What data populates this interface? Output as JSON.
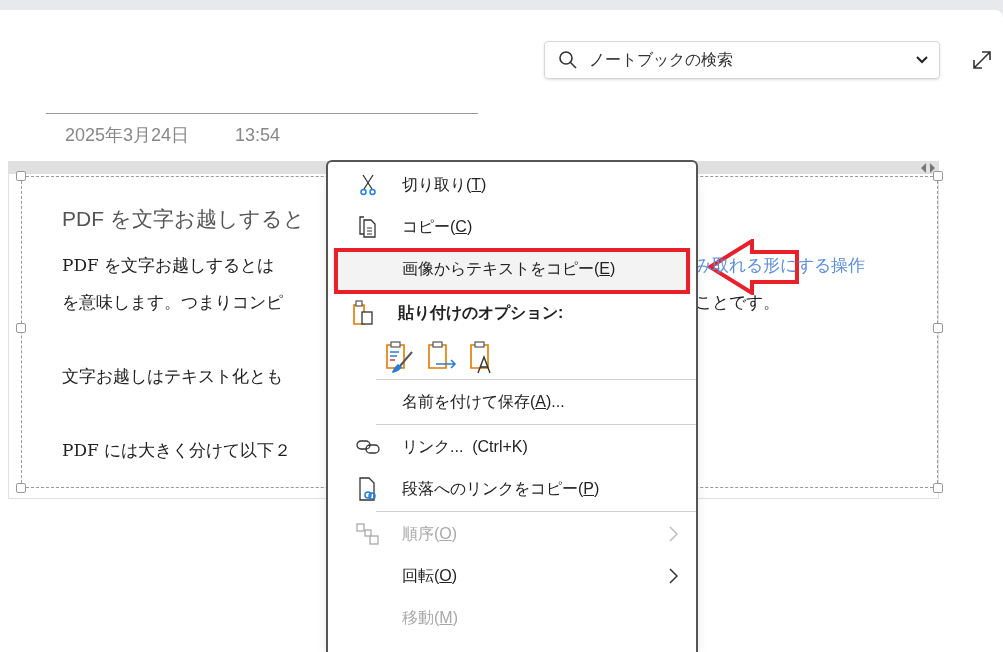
{
  "search": {
    "placeholder": "ノートブックの検索"
  },
  "page": {
    "date": "2025年3月24日",
    "time": "13:54"
  },
  "note": {
    "title": "PDF を文字お越しすると",
    "paragraphs": [
      {
        "kind": "line",
        "segments": [
          {
            "kind": "text",
            "text": "PDF を文字お越しするとは"
          },
          {
            "kind": "link",
            "text": "み取れる形にする操作"
          }
        ]
      },
      {
        "kind": "line",
        "segments": [
          {
            "kind": "text",
            "text": "を意味します。つまりコンピ"
          },
          {
            "kind": "text",
            "text": "ことです。"
          }
        ]
      },
      {
        "kind": "blank"
      },
      {
        "kind": "line",
        "segments": [
          {
            "kind": "text",
            "text": "文字お越しはテキスト化とも"
          }
        ]
      },
      {
        "kind": "blank"
      },
      {
        "kind": "line",
        "segments": [
          {
            "kind": "text",
            "text": "PDF には大きく分けて以下２"
          }
        ]
      }
    ]
  },
  "context_menu": {
    "items": [
      {
        "kind": "item",
        "label": "切り取り(",
        "access_key": "T",
        "label_end": ")",
        "disabled": false,
        "highlighted": false,
        "submenu": false
      },
      {
        "kind": "item",
        "label": "コピー(",
        "access_key": "C",
        "label_end": ")",
        "disabled": false,
        "highlighted": false,
        "submenu": false
      },
      {
        "kind": "item",
        "label": "画像からテキストをコピー(",
        "access_key": "E",
        "label_end": ")",
        "disabled": false,
        "highlighted": true,
        "submenu": false
      },
      {
        "kind": "header",
        "label": "貼り付けのオプション:"
      },
      {
        "kind": "paste_options"
      },
      {
        "kind": "divider"
      },
      {
        "kind": "item",
        "label": "名前を付けて保存(",
        "access_key": "A",
        "label_end": ")...",
        "disabled": false,
        "highlighted": false,
        "submenu": false
      },
      {
        "kind": "divider"
      },
      {
        "kind": "item",
        "label": "リンク...  (Ctrl+K)",
        "disabled": false,
        "highlighted": false,
        "submenu": false
      },
      {
        "kind": "item",
        "label": "段落へのリンクをコピー(",
        "access_key": "P",
        "label_end": ")",
        "disabled": false,
        "highlighted": false,
        "submenu": false
      },
      {
        "kind": "divider"
      },
      {
        "kind": "item",
        "label": "順序(",
        "access_key": "O",
        "label_end": ")",
        "disabled": true,
        "highlighted": false,
        "submenu": true
      },
      {
        "kind": "item",
        "label": "回転(",
        "access_key": "O",
        "label_end": ")",
        "disabled": false,
        "highlighted": false,
        "submenu": true
      },
      {
        "kind": "item",
        "label": "移動(",
        "access_key": "M",
        "label_end": ")",
        "disabled": true,
        "highlighted": false,
        "submenu": false
      }
    ]
  },
  "annotation": {
    "kind": "red_box_arrow"
  }
}
